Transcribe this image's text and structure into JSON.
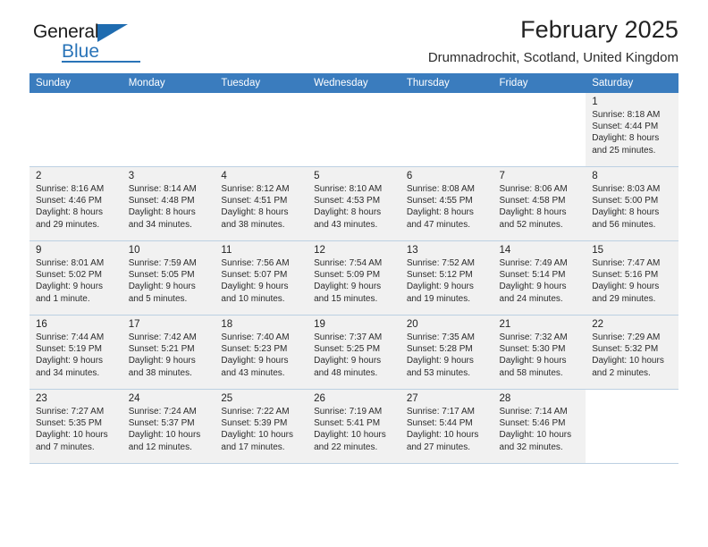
{
  "brand": {
    "name_part1": "General",
    "name_part2": "Blue",
    "accent_color": "#2a74b8"
  },
  "header": {
    "title": "February 2025",
    "location": "Drumnadrochit, Scotland, United Kingdom"
  },
  "calendar": {
    "header_bg": "#3a7cbe",
    "weekdays": [
      "Sunday",
      "Monday",
      "Tuesday",
      "Wednesday",
      "Thursday",
      "Friday",
      "Saturday"
    ],
    "weeks": [
      [
        {
          "day": "",
          "sunrise": "",
          "sunset": "",
          "daylight1": "",
          "daylight2": ""
        },
        {
          "day": "",
          "sunrise": "",
          "sunset": "",
          "daylight1": "",
          "daylight2": ""
        },
        {
          "day": "",
          "sunrise": "",
          "sunset": "",
          "daylight1": "",
          "daylight2": ""
        },
        {
          "day": "",
          "sunrise": "",
          "sunset": "",
          "daylight1": "",
          "daylight2": ""
        },
        {
          "day": "",
          "sunrise": "",
          "sunset": "",
          "daylight1": "",
          "daylight2": ""
        },
        {
          "day": "",
          "sunrise": "",
          "sunset": "",
          "daylight1": "",
          "daylight2": ""
        },
        {
          "day": "1",
          "sunrise": "Sunrise: 8:18 AM",
          "sunset": "Sunset: 4:44 PM",
          "daylight1": "Daylight: 8 hours",
          "daylight2": "and 25 minutes."
        }
      ],
      [
        {
          "day": "2",
          "sunrise": "Sunrise: 8:16 AM",
          "sunset": "Sunset: 4:46 PM",
          "daylight1": "Daylight: 8 hours",
          "daylight2": "and 29 minutes."
        },
        {
          "day": "3",
          "sunrise": "Sunrise: 8:14 AM",
          "sunset": "Sunset: 4:48 PM",
          "daylight1": "Daylight: 8 hours",
          "daylight2": "and 34 minutes."
        },
        {
          "day": "4",
          "sunrise": "Sunrise: 8:12 AM",
          "sunset": "Sunset: 4:51 PM",
          "daylight1": "Daylight: 8 hours",
          "daylight2": "and 38 minutes."
        },
        {
          "day": "5",
          "sunrise": "Sunrise: 8:10 AM",
          "sunset": "Sunset: 4:53 PM",
          "daylight1": "Daylight: 8 hours",
          "daylight2": "and 43 minutes."
        },
        {
          "day": "6",
          "sunrise": "Sunrise: 8:08 AM",
          "sunset": "Sunset: 4:55 PM",
          "daylight1": "Daylight: 8 hours",
          "daylight2": "and 47 minutes."
        },
        {
          "day": "7",
          "sunrise": "Sunrise: 8:06 AM",
          "sunset": "Sunset: 4:58 PM",
          "daylight1": "Daylight: 8 hours",
          "daylight2": "and 52 minutes."
        },
        {
          "day": "8",
          "sunrise": "Sunrise: 8:03 AM",
          "sunset": "Sunset: 5:00 PM",
          "daylight1": "Daylight: 8 hours",
          "daylight2": "and 56 minutes."
        }
      ],
      [
        {
          "day": "9",
          "sunrise": "Sunrise: 8:01 AM",
          "sunset": "Sunset: 5:02 PM",
          "daylight1": "Daylight: 9 hours",
          "daylight2": "and 1 minute."
        },
        {
          "day": "10",
          "sunrise": "Sunrise: 7:59 AM",
          "sunset": "Sunset: 5:05 PM",
          "daylight1": "Daylight: 9 hours",
          "daylight2": "and 5 minutes."
        },
        {
          "day": "11",
          "sunrise": "Sunrise: 7:56 AM",
          "sunset": "Sunset: 5:07 PM",
          "daylight1": "Daylight: 9 hours",
          "daylight2": "and 10 minutes."
        },
        {
          "day": "12",
          "sunrise": "Sunrise: 7:54 AM",
          "sunset": "Sunset: 5:09 PM",
          "daylight1": "Daylight: 9 hours",
          "daylight2": "and 15 minutes."
        },
        {
          "day": "13",
          "sunrise": "Sunrise: 7:52 AM",
          "sunset": "Sunset: 5:12 PM",
          "daylight1": "Daylight: 9 hours",
          "daylight2": "and 19 minutes."
        },
        {
          "day": "14",
          "sunrise": "Sunrise: 7:49 AM",
          "sunset": "Sunset: 5:14 PM",
          "daylight1": "Daylight: 9 hours",
          "daylight2": "and 24 minutes."
        },
        {
          "day": "15",
          "sunrise": "Sunrise: 7:47 AM",
          "sunset": "Sunset: 5:16 PM",
          "daylight1": "Daylight: 9 hours",
          "daylight2": "and 29 minutes."
        }
      ],
      [
        {
          "day": "16",
          "sunrise": "Sunrise: 7:44 AM",
          "sunset": "Sunset: 5:19 PM",
          "daylight1": "Daylight: 9 hours",
          "daylight2": "and 34 minutes."
        },
        {
          "day": "17",
          "sunrise": "Sunrise: 7:42 AM",
          "sunset": "Sunset: 5:21 PM",
          "daylight1": "Daylight: 9 hours",
          "daylight2": "and 38 minutes."
        },
        {
          "day": "18",
          "sunrise": "Sunrise: 7:40 AM",
          "sunset": "Sunset: 5:23 PM",
          "daylight1": "Daylight: 9 hours",
          "daylight2": "and 43 minutes."
        },
        {
          "day": "19",
          "sunrise": "Sunrise: 7:37 AM",
          "sunset": "Sunset: 5:25 PM",
          "daylight1": "Daylight: 9 hours",
          "daylight2": "and 48 minutes."
        },
        {
          "day": "20",
          "sunrise": "Sunrise: 7:35 AM",
          "sunset": "Sunset: 5:28 PM",
          "daylight1": "Daylight: 9 hours",
          "daylight2": "and 53 minutes."
        },
        {
          "day": "21",
          "sunrise": "Sunrise: 7:32 AM",
          "sunset": "Sunset: 5:30 PM",
          "daylight1": "Daylight: 9 hours",
          "daylight2": "and 58 minutes."
        },
        {
          "day": "22",
          "sunrise": "Sunrise: 7:29 AM",
          "sunset": "Sunset: 5:32 PM",
          "daylight1": "Daylight: 10 hours",
          "daylight2": "and 2 minutes."
        }
      ],
      [
        {
          "day": "23",
          "sunrise": "Sunrise: 7:27 AM",
          "sunset": "Sunset: 5:35 PM",
          "daylight1": "Daylight: 10 hours",
          "daylight2": "and 7 minutes."
        },
        {
          "day": "24",
          "sunrise": "Sunrise: 7:24 AM",
          "sunset": "Sunset: 5:37 PM",
          "daylight1": "Daylight: 10 hours",
          "daylight2": "and 12 minutes."
        },
        {
          "day": "25",
          "sunrise": "Sunrise: 7:22 AM",
          "sunset": "Sunset: 5:39 PM",
          "daylight1": "Daylight: 10 hours",
          "daylight2": "and 17 minutes."
        },
        {
          "day": "26",
          "sunrise": "Sunrise: 7:19 AM",
          "sunset": "Sunset: 5:41 PM",
          "daylight1": "Daylight: 10 hours",
          "daylight2": "and 22 minutes."
        },
        {
          "day": "27",
          "sunrise": "Sunrise: 7:17 AM",
          "sunset": "Sunset: 5:44 PM",
          "daylight1": "Daylight: 10 hours",
          "daylight2": "and 27 minutes."
        },
        {
          "day": "28",
          "sunrise": "Sunrise: 7:14 AM",
          "sunset": "Sunset: 5:46 PM",
          "daylight1": "Daylight: 10 hours",
          "daylight2": "and 32 minutes."
        },
        {
          "day": "",
          "sunrise": "",
          "sunset": "",
          "daylight1": "",
          "daylight2": ""
        }
      ]
    ]
  }
}
